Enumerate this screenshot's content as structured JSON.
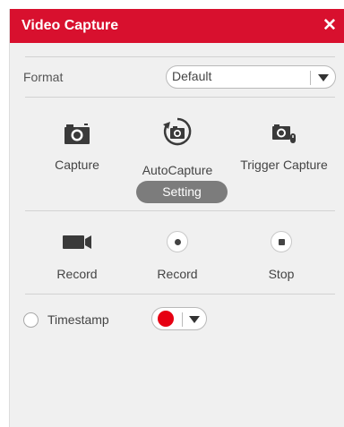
{
  "window": {
    "title": "Video Capture",
    "close_glyph": "✕"
  },
  "format": {
    "label": "Format",
    "selected": "Default"
  },
  "capture_tools": [
    {
      "label": "Capture",
      "icon": "camera-icon"
    },
    {
      "label": "AutoCapture",
      "icon": "auto-capture-icon"
    },
    {
      "label": "Trigger Capture",
      "icon": "trigger-capture-icon"
    }
  ],
  "setting_label": "Setting",
  "record_tools": [
    {
      "label": "Record",
      "icon": "video-camera-icon"
    },
    {
      "label": "Record",
      "icon": "record-dot-icon"
    },
    {
      "label": "Stop",
      "icon": "stop-square-icon"
    }
  ],
  "timestamp": {
    "label": "Timestamp",
    "checked": false,
    "color": "#e60012"
  },
  "colors": {
    "accent": "#d8102e",
    "button_gray": "#7c7c7c",
    "panel_bg": "#f0f0f0"
  }
}
